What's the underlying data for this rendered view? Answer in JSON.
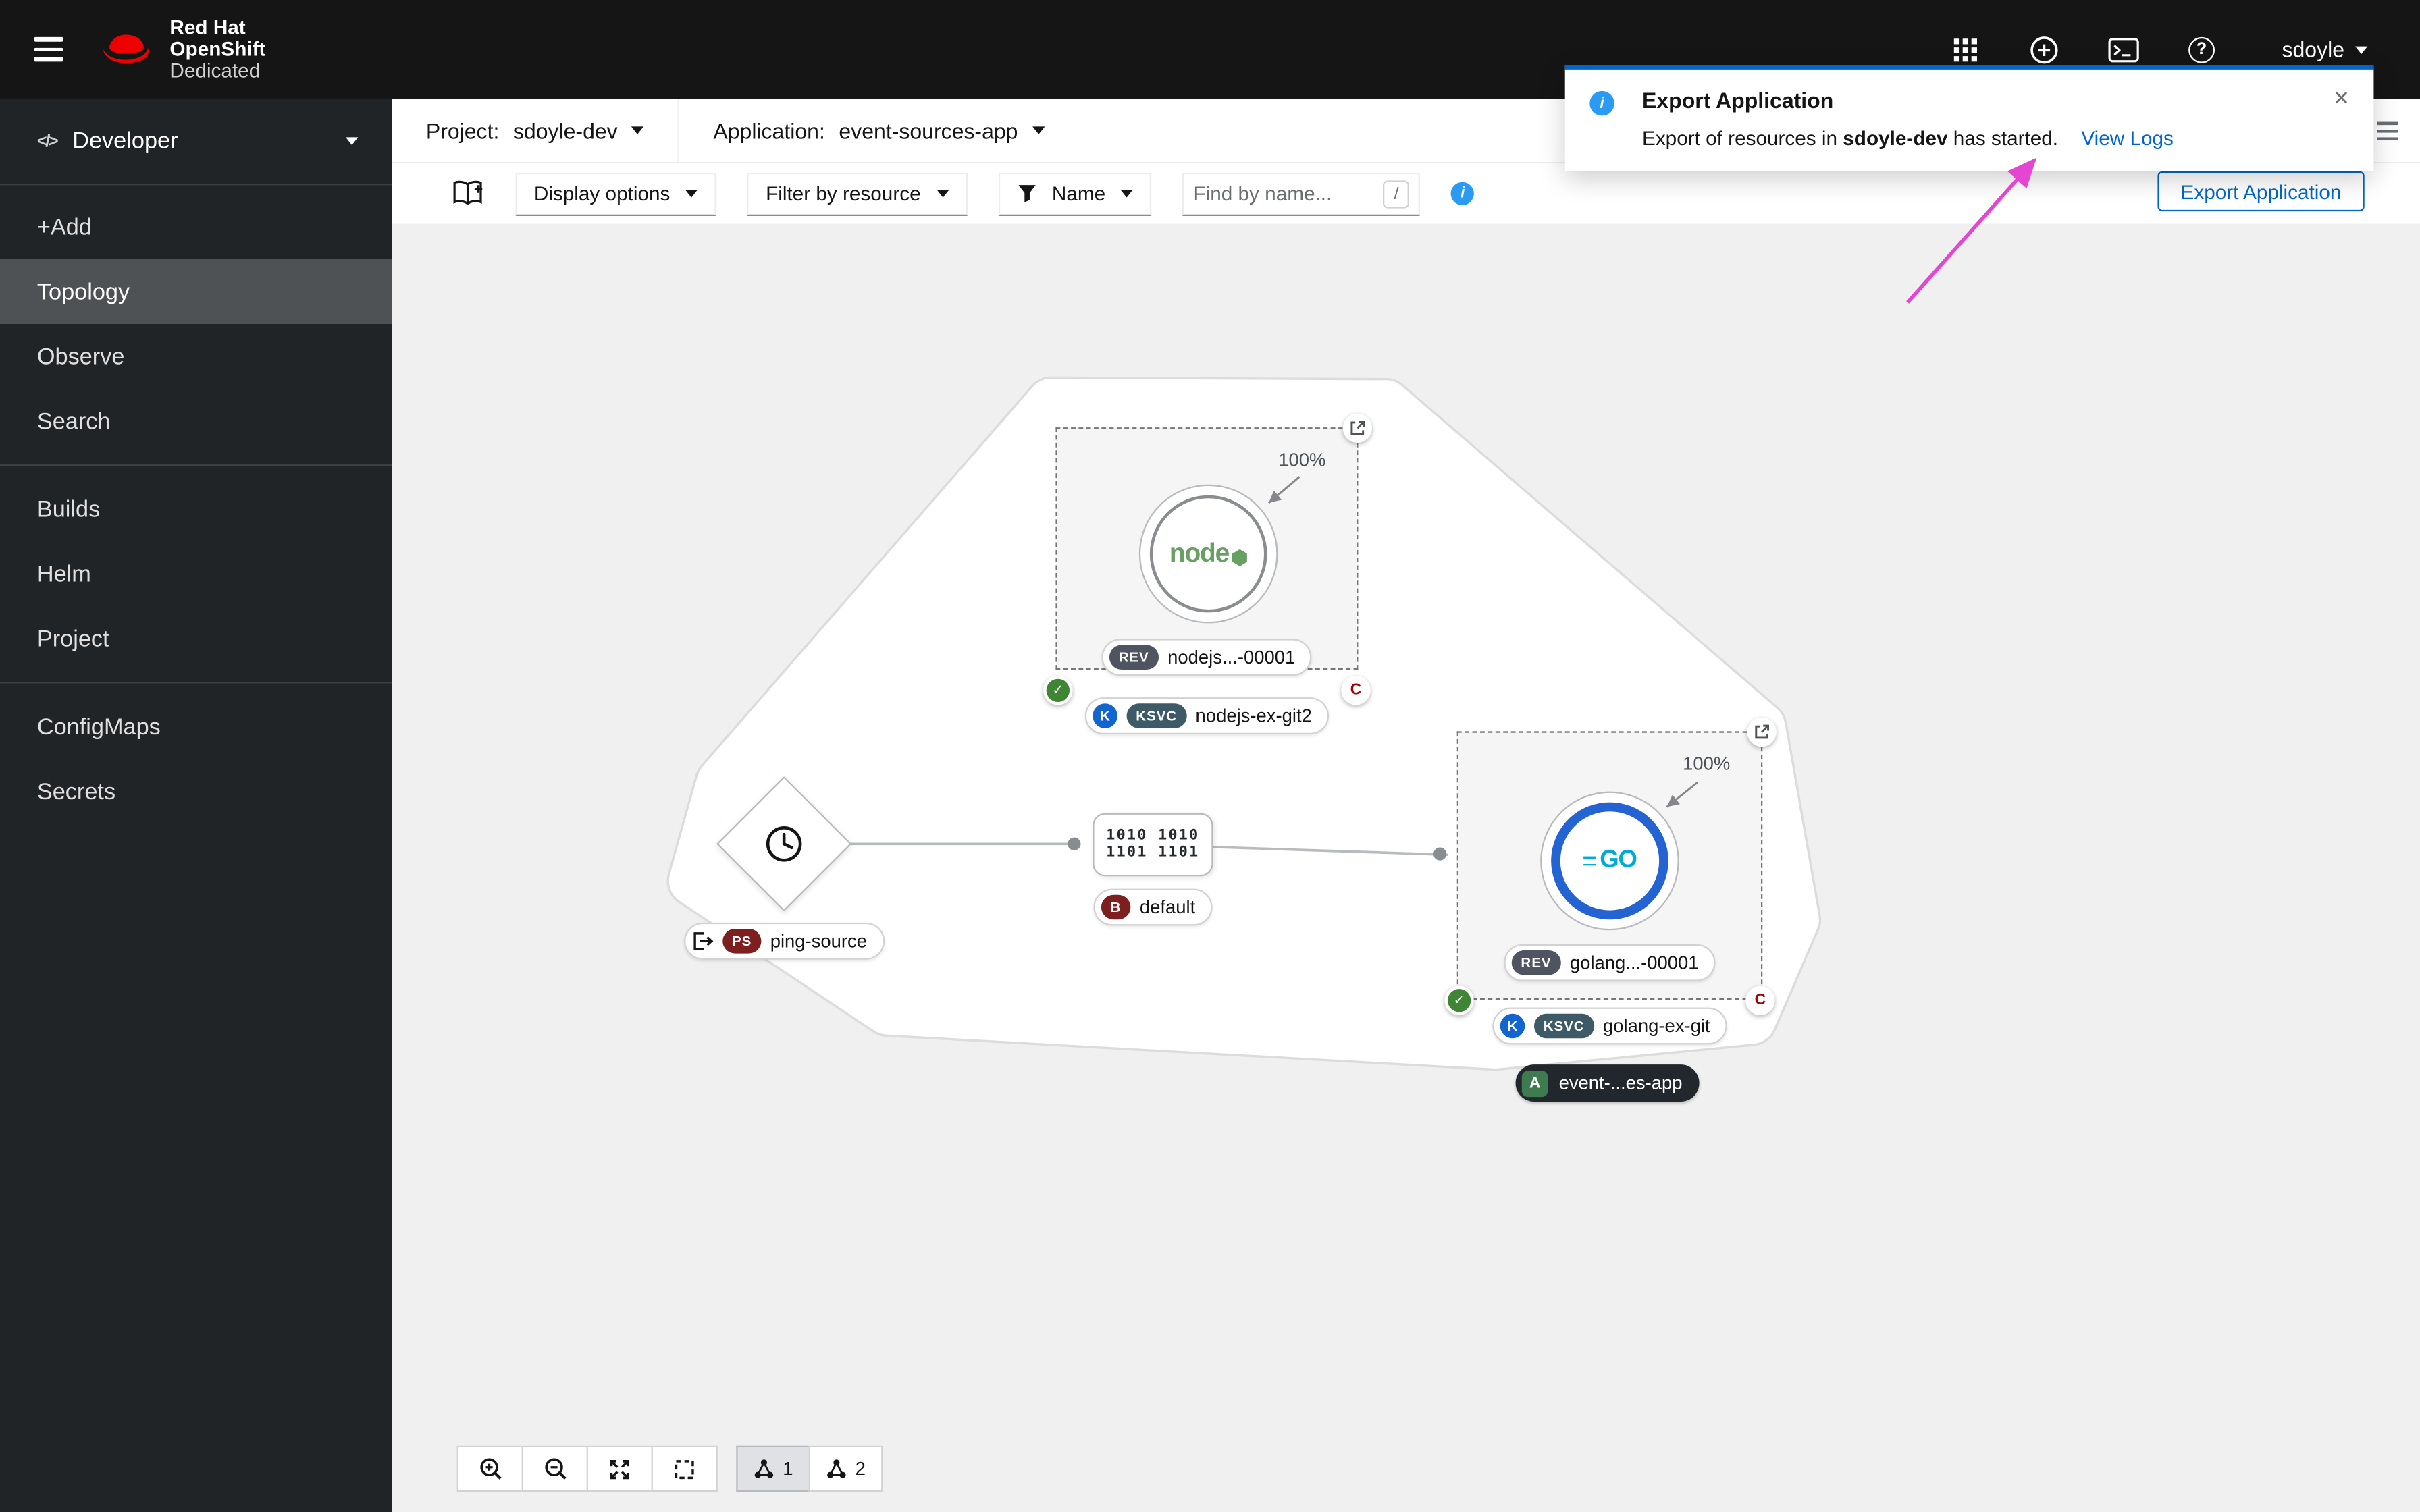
{
  "masthead": {
    "brand_line1": "Red Hat",
    "brand_line2": "OpenShift",
    "brand_line3": "Dedicated",
    "username": "sdoyle"
  },
  "sidebar": {
    "perspective": "Developer",
    "items": [
      {
        "label": "+Add",
        "selected": false
      },
      {
        "label": "Topology",
        "selected": true
      },
      {
        "label": "Observe",
        "selected": false
      },
      {
        "label": "Search",
        "selected": false
      },
      {
        "label": "Builds",
        "selected": false
      },
      {
        "label": "Helm",
        "selected": false
      },
      {
        "label": "Project",
        "selected": false
      },
      {
        "label": "ConfigMaps",
        "selected": false
      },
      {
        "label": "Secrets",
        "selected": false
      }
    ]
  },
  "context_bar": {
    "project_label": "Project:",
    "project_value": "sdoyle-dev",
    "application_label": "Application:",
    "application_value": "event-sources-app"
  },
  "toolbar": {
    "display_options": "Display options",
    "filter_by_resource": "Filter by resource",
    "name_filter": "Name",
    "find_placeholder": "Find by name...",
    "shortcut_key": "/",
    "export_button": "Export Application"
  },
  "toast": {
    "title": "Export Application",
    "message_prefix": "Export of resources in ",
    "project": "sdoyle-dev",
    "message_suffix": " has started.",
    "action": "View Logs"
  },
  "topology": {
    "application": {
      "badge": "A",
      "name": "event-...es-app"
    },
    "nodejs": {
      "traffic": "100%",
      "revision_badge": "REV",
      "revision_name": "nodejs...-00001",
      "service_badge": "KSVC",
      "service_name": "nodejs-ex-git2",
      "logo_text": "node"
    },
    "golang": {
      "traffic": "100%",
      "revision_badge": "REV",
      "revision_name": "golang...-00001",
      "service_badge": "KSVC",
      "service_name": "golang-ex-git",
      "logo_text": "GO"
    },
    "ping_source": {
      "badge": "PS",
      "name": "ping-source"
    },
    "channel": {
      "badge": "B",
      "name": "default",
      "icon_line1": "1010 1010",
      "icon_line2": "1101 1101"
    },
    "knative_icon_letter": "K"
  },
  "controls": {
    "layout1_label": "1",
    "layout2_label": "2"
  },
  "icons": {
    "dev_glyph": "</>",
    "close_glyph": "✕",
    "help_glyph": "?",
    "info_glyph": "i",
    "check_glyph": "✓",
    "che_glyph": "C"
  },
  "colors": {
    "masthead_bg": "#151515",
    "sidebar_bg": "#212427",
    "sidebar_selected": "#4f5255",
    "accent_blue": "#0066cc",
    "info_blue": "#2b9af3",
    "canvas_bg": "#f0f0f0",
    "annotation_pink": "#e445d2",
    "status_green": "#3e8635",
    "source_badge_red": "#7d1f1f",
    "revision_badge_slate": "#4f5560",
    "service_badge_teal": "#3d5a66",
    "application_green": "#3e7b4f",
    "go_ring_blue": "#2363d2",
    "node_green": "#689f63",
    "go_text_cyan": "#00acd7",
    "redhat_red": "#ee0000"
  }
}
